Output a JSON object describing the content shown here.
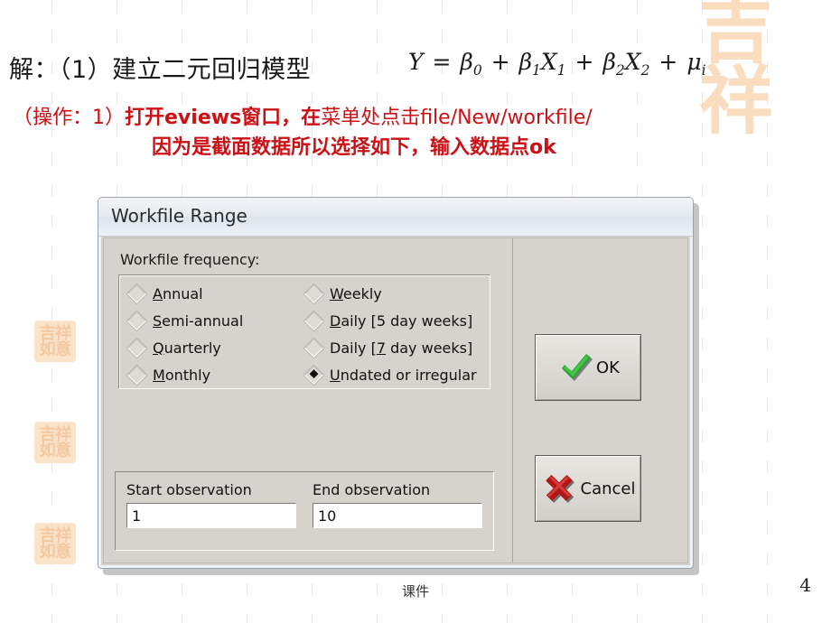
{
  "slide": {
    "heading": "解：（1）建立二元回归模型",
    "formula": {
      "lhs": "Y",
      "eq": "=",
      "terms": [
        "β0",
        "β1X1",
        "β2X2",
        "μi"
      ],
      "plain": "Y = β0 + β1X1 + β2X2 + μi"
    },
    "note_line1_prefix": "（操作：1）",
    "note_line1_bold": "打开",
    "note_line1_mid": "eviews",
    "note_line1_bold2": "窗口，在",
    "note_line1_rest": "菜单处点击file/New/workfile/",
    "note_line2": "因为是截面数据所以选择如下，输入数据点ok",
    "note_color": "#cc1116"
  },
  "dialog": {
    "title": "Workfile Range",
    "frequency_label": "Workfile frequency:",
    "frequencies": [
      {
        "label": "Annual",
        "accel": "A",
        "selected": false,
        "column": "left"
      },
      {
        "label": "Weekly",
        "accel": "W",
        "selected": false,
        "column": "right"
      },
      {
        "label": "Semi-annual",
        "accel": "S",
        "selected": false,
        "column": "left"
      },
      {
        "label": "Daily [5 day weeks]",
        "accel": "D",
        "selected": false,
        "column": "right"
      },
      {
        "label": "Quarterly",
        "accel": "Q",
        "selected": false,
        "column": "left"
      },
      {
        "label": "Daily [7 day weeks]",
        "accel": "7",
        "selected": false,
        "column": "right"
      },
      {
        "label": "Monthly",
        "accel": "M",
        "selected": false,
        "column": "left"
      },
      {
        "label": "Undated or irregular",
        "accel": "U",
        "selected": true,
        "column": "right"
      }
    ],
    "start_observation": {
      "label": "Start observation",
      "value": "1"
    },
    "end_observation": {
      "label": "End observation",
      "value": "10"
    },
    "buttons": {
      "ok": {
        "label": "OK",
        "icon": "green-check-icon",
        "color": "#1f9c29"
      },
      "cancel": {
        "label": "Cancel",
        "icon": "red-cross-icon",
        "color": "#b91515"
      }
    }
  },
  "footer": {
    "note": "课件",
    "page_number": "4"
  },
  "watermark": {
    "text": "吉祥如意",
    "chars": [
      "吉",
      "祥",
      "如",
      "意"
    ],
    "color": "#fadcbc"
  }
}
